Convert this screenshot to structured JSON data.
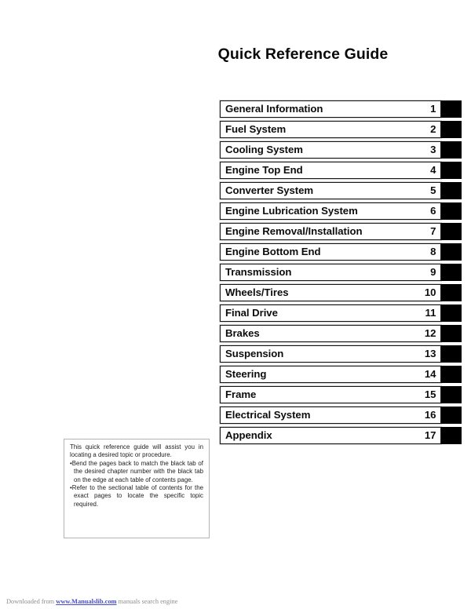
{
  "page": {
    "title": "Quick Reference Guide",
    "background_color": "#ffffff",
    "tab_color": "#000000",
    "text_color": "#0d0d0d"
  },
  "chapter_index": {
    "rows": [
      {
        "label": "General Information",
        "number": "1"
      },
      {
        "label": "Fuel System",
        "number": "2"
      },
      {
        "label": "Cooling System",
        "number": "3"
      },
      {
        "label": "Engine Top End",
        "number": "4"
      },
      {
        "label": "Converter System",
        "number": "5"
      },
      {
        "label": "Engine Lubrication System",
        "number": "6"
      },
      {
        "label": "Engine Removal/Installation",
        "number": "7"
      },
      {
        "label": "Engine Bottom End",
        "number": "8"
      },
      {
        "label": "Transmission",
        "number": "9"
      },
      {
        "label": "Wheels/Tires",
        "number": "10"
      },
      {
        "label": "Final Drive",
        "number": "11"
      },
      {
        "label": "Brakes",
        "number": "12"
      },
      {
        "label": "Suspension",
        "number": "13"
      },
      {
        "label": "Steering",
        "number": "14"
      },
      {
        "label": "Frame",
        "number": "15"
      },
      {
        "label": "Electrical System",
        "number": "16"
      },
      {
        "label": "Appendix",
        "number": "17"
      }
    ]
  },
  "note_box": {
    "intro": "This quick reference guide will assist you in locating a desired topic or procedure.",
    "bullet_mark": "•",
    "bullets": [
      "Bend the pages back to match the black tab of the desired chapter number with the black tab on the edge at each table of contents page.",
      "Refer to the sectional table of contents for the exact pages to locate the specific topic required."
    ]
  },
  "footer": {
    "prefix": "Downloaded from ",
    "link": "www.Manualslib.com",
    "suffix": " manuals search engine",
    "link_color": "#4a4ad0"
  }
}
